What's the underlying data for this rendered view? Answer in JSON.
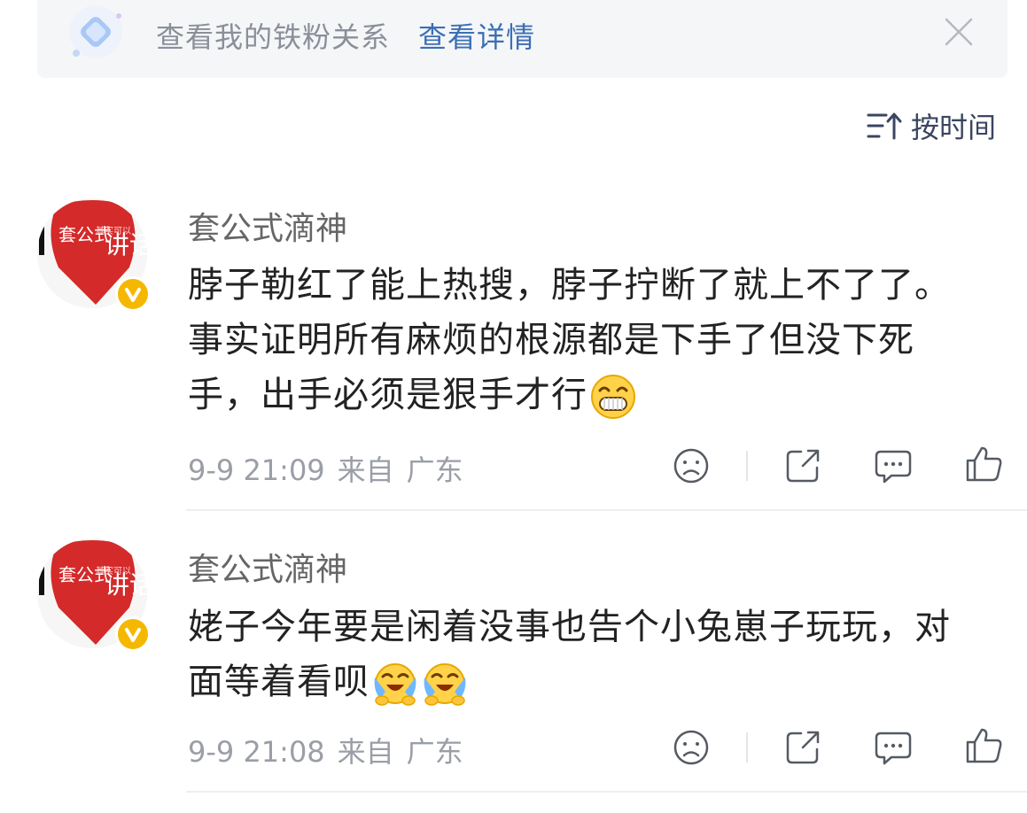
{
  "banner": {
    "icon": "diamond-badge-icon",
    "text": "查看我的铁粉关系",
    "link": "查看详情",
    "close_icon": "close-icon"
  },
  "sort": {
    "icon": "sort-icon",
    "label": "按时间"
  },
  "comments": [
    {
      "username": "套公式滴神",
      "verified": true,
      "text": "脖子勒红了能上热搜，脖子拧断了就上不了了。事实证明所有麻烦的根源都是下手了但没下死手，出手必须是狠手才行",
      "emojis": [
        "grin-emoji"
      ],
      "time": "9-9 21:09",
      "from": "来自",
      "location": "广东"
    },
    {
      "username": "套公式滴神",
      "verified": true,
      "text": "姥子今年要是闲着没事也告个小兔崽子玩玩，对面等着看呗",
      "emojis": [
        "crying-laugh-emoji",
        "crying-laugh-emoji"
      ],
      "time": "9-9 21:08",
      "from": "来自",
      "location": "广东"
    }
  ],
  "avatar_text": {
    "main": "套公式",
    "side": "讲话",
    "small": "其实可以"
  },
  "colors": {
    "link": "#3b6fb5",
    "avatar_red": "#d42a2a",
    "badge": "#f5b800",
    "emoji_yellow": "#ffd24a"
  }
}
